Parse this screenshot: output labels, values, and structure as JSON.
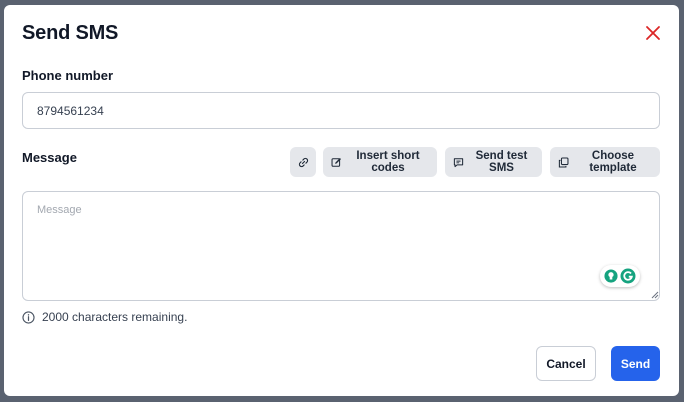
{
  "dialog": {
    "title": "Send SMS"
  },
  "phone": {
    "label": "Phone number",
    "value": "8794561234"
  },
  "message": {
    "label": "Message",
    "placeholder": "Message",
    "value": ""
  },
  "toolbar": {
    "insert_short_codes": "Insert short codes",
    "send_test_sms": "Send test SMS",
    "choose_template": "Choose template"
  },
  "counter": {
    "text": "2000 characters remaining."
  },
  "footer": {
    "cancel_label": "Cancel",
    "send_label": "Send"
  },
  "colors": {
    "primary": "#2563eb",
    "close": "#dc2626",
    "grammarly": "#15a37f"
  },
  "icons": {
    "close": "close-icon",
    "link": "link-icon",
    "edit": "edit-icon",
    "chat": "chat-icon",
    "copy": "copy-icon",
    "info": "info-icon"
  }
}
